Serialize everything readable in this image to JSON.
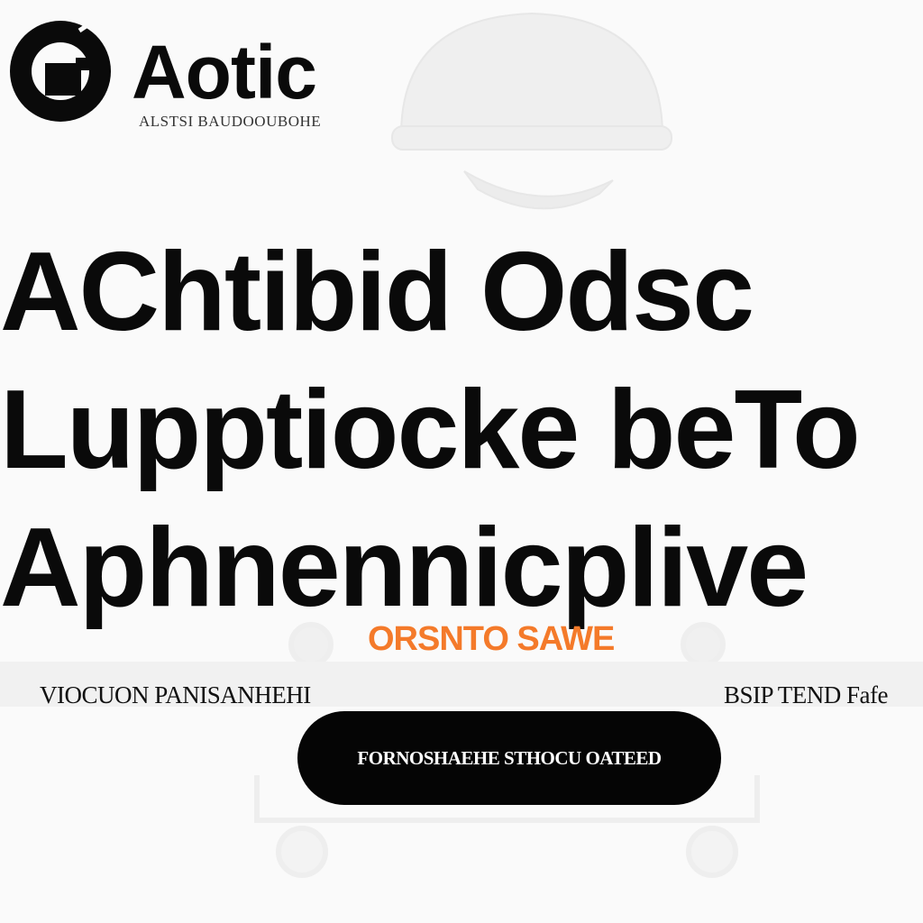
{
  "brand": {
    "name": "Aotic",
    "tagline": "ALSTSI BAUDOOUBOHE"
  },
  "headline": {
    "lines": [
      "AChtibid Odsc",
      "Lupptiocke beTo",
      "Aphnennicplive"
    ]
  },
  "offer": {
    "label": "ORSNTO SAWE",
    "color": "#f47a2a"
  },
  "info": {
    "left": "VIOCUON PANISANHEHI",
    "right": "BSIP TEND Fafe"
  },
  "cta": {
    "label": "FORNOSHAEHE STHOCU OATEED"
  },
  "icons": {
    "logo": "logo-mark-icon",
    "background": [
      "helmet-illustration",
      "trolley-illustration"
    ]
  }
}
